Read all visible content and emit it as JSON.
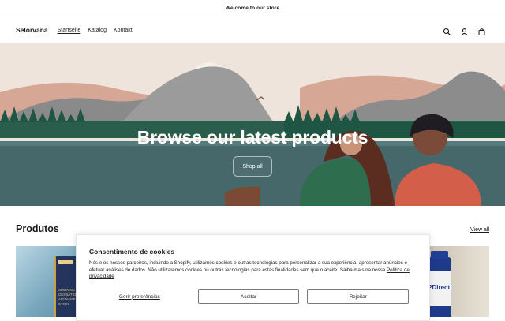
{
  "announcement": "Welcome to our store",
  "header": {
    "logo": "Selorvana",
    "nav": [
      "Startseite",
      "Katalog",
      "Kontakt"
    ],
    "icons": [
      "search-icon",
      "account-icon",
      "cart-icon"
    ]
  },
  "hero": {
    "title": "Browse our latest products",
    "button": "Shop all"
  },
  "products": {
    "title": "Produtos",
    "view_all": "View all",
    "left_card_text": "SMOKING CESSATION AID NAMELESS STICK",
    "right_card_text": "2Direct"
  },
  "cookie": {
    "title": "Consentimento de cookies",
    "text": "Nós e os nossos parceiros, incluindo a Shopify, utilizamos cookies e outras tecnologias para personalizar a sua experiência, apresentar anúncios e efetuar análises de dados. Não utilizaremos cookies ou outras tecnologias para estas finalidades sem que o aceite. Saiba mais na nossa",
    "link": "Política de privacidade",
    "preferences": "Gerir preferências",
    "accept": "Aceitar",
    "reject": "Rejeitar"
  },
  "colors": {
    "sky": "#f1e6dd",
    "lake": "#43696c",
    "trees": "#1f5c48",
    "brand_text": "#1a1a1a"
  }
}
